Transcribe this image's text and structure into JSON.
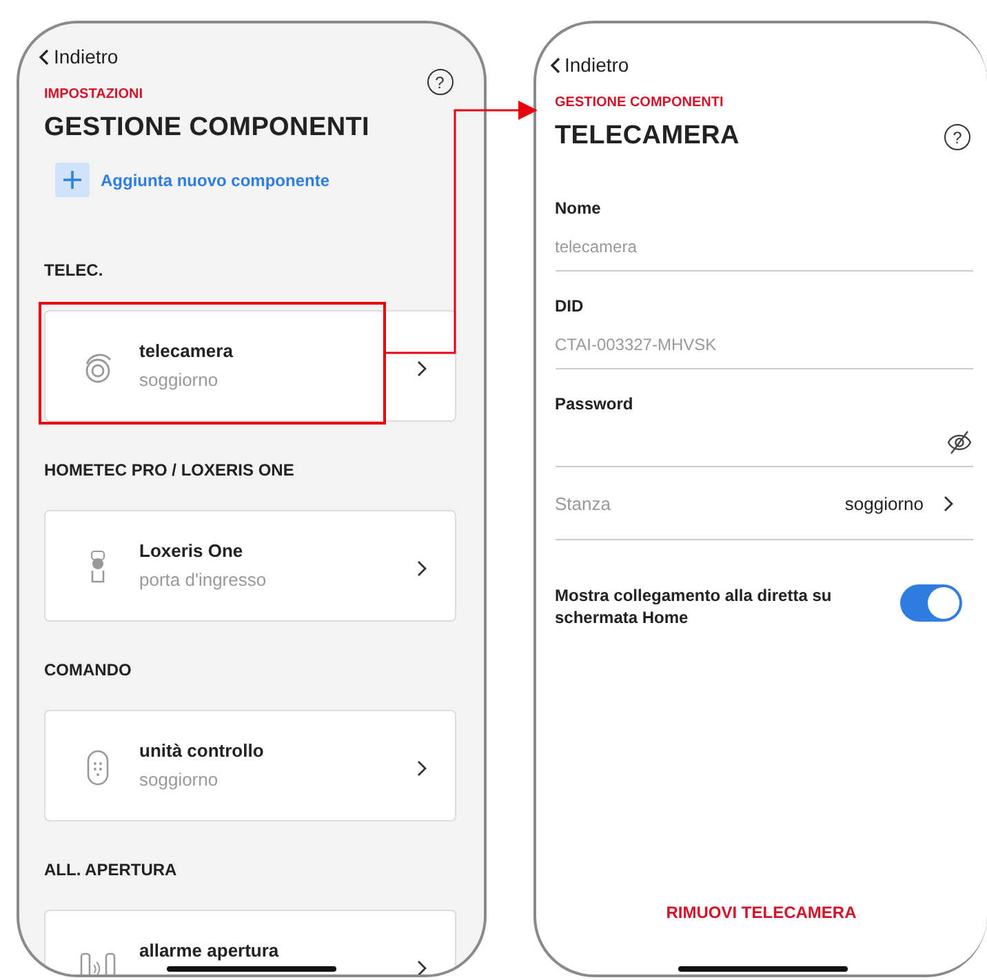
{
  "left_screen": {
    "back": "Indietro",
    "overline": "IMPOSTAZIONI",
    "title": "GESTIONE COMPONENTI",
    "add_button": "Aggiunta nuovo componente",
    "sections": [
      {
        "heading": "TELEC.",
        "items": [
          {
            "kind": "camera",
            "name": "telecamera",
            "location": "soggiorno",
            "highlighted": true
          }
        ]
      },
      {
        "heading": "HOMETEC PRO / LOXERIS ONE",
        "items": [
          {
            "kind": "lock",
            "name": "Loxeris One",
            "location": "porta d'ingresso",
            "highlighted": false
          }
        ]
      },
      {
        "heading": "COMANDO",
        "items": [
          {
            "kind": "keypad",
            "name": "unità controllo",
            "location": "soggiorno",
            "highlighted": false
          }
        ]
      },
      {
        "heading": "ALL. APERTURA",
        "items": [
          {
            "kind": "contact",
            "name": "allarme apertura",
            "highlighted": false
          }
        ]
      }
    ],
    "help": "?"
  },
  "right_screen": {
    "back": "Indietro",
    "overline": "GESTIONE COMPONENTI",
    "title": "TELECAMERA",
    "fields": [
      {
        "kind": "text",
        "label": "Nome",
        "value": "telecamera"
      },
      {
        "kind": "text",
        "label": "DID",
        "value": "CTAI-003327-MHVSK"
      },
      {
        "kind": "password",
        "label": "Password"
      }
    ],
    "room": {
      "label": "Stanza",
      "value": "soggiorno"
    },
    "toggle": {
      "label": "Mostra collegamento alla diretta su schermata Home",
      "on": true
    },
    "remove_button": "RIMUOVI TELECAMERA",
    "help": "?"
  }
}
